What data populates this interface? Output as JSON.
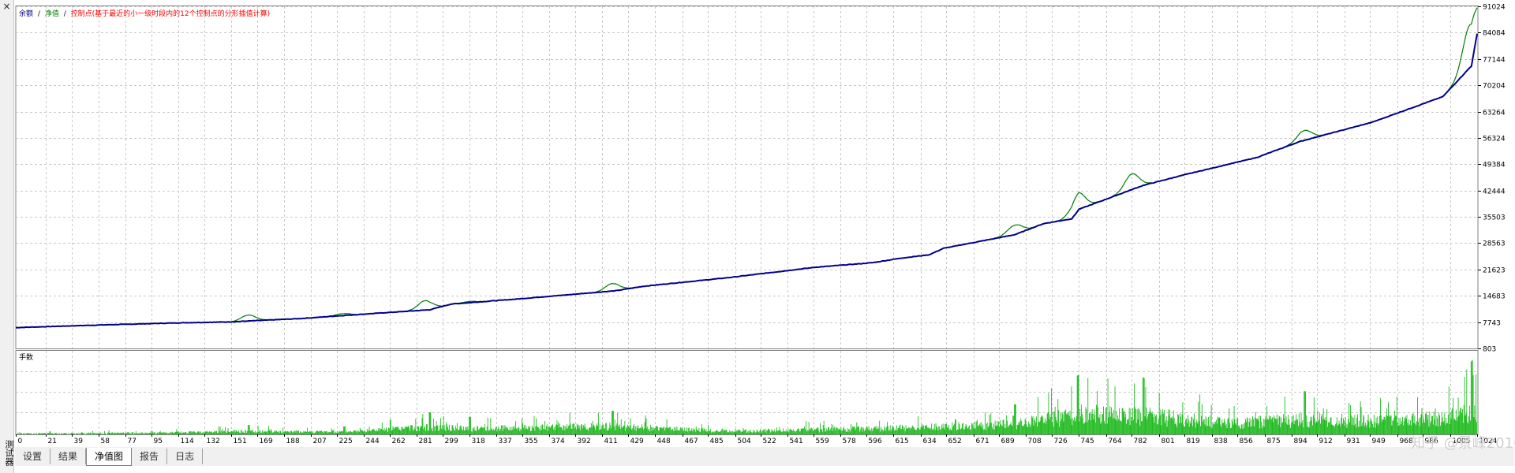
{
  "window": {
    "close_glyph": "×",
    "side_label": "测试器"
  },
  "legend": {
    "balance_label": "余额",
    "sep1": "/",
    "equity_label": "净值",
    "sep2": "/",
    "ticks_label": "控制点(基于最近的小一级时段内的12个控制点的分形插值计算)"
  },
  "lower_panel": {
    "title": "手数"
  },
  "tabs": [
    {
      "label": "设置",
      "active": false
    },
    {
      "label": "结果",
      "active": false
    },
    {
      "label": "净值图",
      "active": true
    },
    {
      "label": "报告",
      "active": false
    },
    {
      "label": "日志",
      "active": false
    }
  ],
  "watermark": "知乎 @景峰2016",
  "colors": {
    "balance": "#00008b",
    "equity": "#008000",
    "ticks": "#ff0000",
    "volume": "#22bb22",
    "grid": "#c8c8c8"
  },
  "chart_data": [
    {
      "type": "line",
      "title": "",
      "series": [
        {
          "name": "余额"
        },
        {
          "name": "净值"
        }
      ],
      "y_ticks": [
        803,
        7743,
        14683,
        21623,
        28563,
        35503,
        42444,
        49384,
        56324,
        63264,
        70204,
        77144,
        84084,
        91024
      ],
      "ylim": [
        803,
        91024
      ],
      "xlim": [
        0,
        1024
      ],
      "x": [
        0,
        60,
        120,
        150,
        200,
        230,
        290,
        305,
        350,
        420,
        440,
        500,
        560,
        600,
        620,
        640,
        650,
        700,
        720,
        740,
        745,
        790,
        820,
        870,
        900,
        950,
        1000,
        1020,
        1024
      ],
      "balance": [
        6300,
        7000,
        7600,
        7800,
        8700,
        9500,
        11000,
        12500,
        13800,
        16000,
        17200,
        19500,
        22200,
        23400,
        24600,
        25500,
        27200,
        30800,
        33700,
        35000,
        37500,
        43800,
        46700,
        51200,
        55400,
        60400,
        67200,
        75300,
        83800
      ],
      "equity_bumps": [
        {
          "x": 163,
          "y": 9600
        },
        {
          "x": 229,
          "y": 10000
        },
        {
          "x": 287,
          "y": 13400
        },
        {
          "x": 318,
          "y": 13200
        },
        {
          "x": 418,
          "y": 17900
        },
        {
          "x": 700,
          "y": 33300
        },
        {
          "x": 744,
          "y": 41500
        },
        {
          "x": 782,
          "y": 46800
        },
        {
          "x": 903,
          "y": 58300
        },
        {
          "x": 1019,
          "y": 86200
        }
      ]
    },
    {
      "type": "bar",
      "title": "手数",
      "x_ticks": [
        0,
        21,
        39,
        58,
        77,
        95,
        114,
        132,
        151,
        169,
        188,
        207,
        225,
        244,
        262,
        281,
        299,
        318,
        337,
        355,
        374,
        392,
        411,
        429,
        448,
        467,
        485,
        504,
        522,
        541,
        559,
        578,
        596,
        615,
        634,
        652,
        671,
        689,
        708,
        726,
        745,
        764,
        782,
        801,
        819,
        838,
        856,
        875,
        894,
        912,
        931,
        949,
        968,
        986,
        1005,
        1024
      ],
      "x": [
        0,
        50,
        100,
        160,
        230,
        290,
        320,
        420,
        500,
        600,
        650,
        700,
        750,
        790,
        850,
        900,
        950,
        1000,
        1024
      ],
      "values": [
        0.04,
        0.05,
        0.06,
        0.12,
        0.1,
        0.28,
        0.22,
        0.3,
        0.12,
        0.22,
        0.3,
        0.38,
        0.8,
        0.72,
        0.42,
        0.55,
        0.5,
        0.6,
        1.0
      ]
    }
  ]
}
